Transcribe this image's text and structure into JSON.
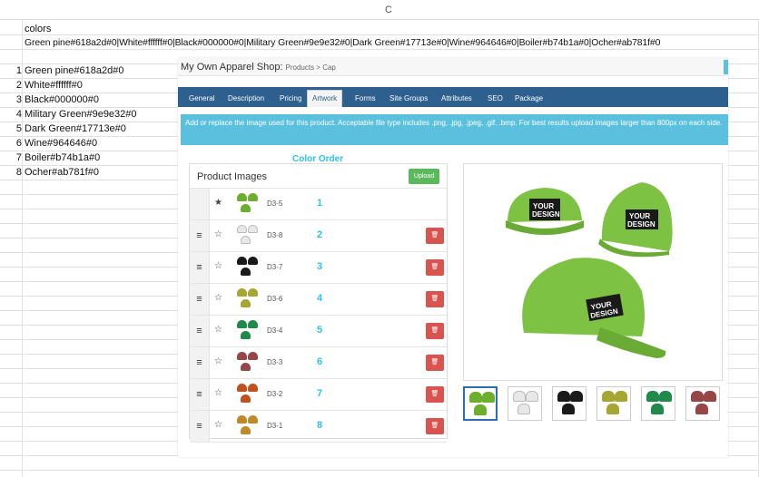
{
  "sheet": {
    "column_letter": "C",
    "header_cell": "colors",
    "colors_string": "Green pine#618a2d#0|White#ffffff#0|Black#000000#0|Military Green#9e9e32#0|Dark Green#17713e#0|Wine#964646#0|Boiler#b74b1a#0|Ocher#ab781f#0",
    "rows": [
      {
        "num": "1",
        "value": "Green pine#618a2d#0"
      },
      {
        "num": "2",
        "value": "White#ffffff#0"
      },
      {
        "num": "3",
        "value": "Black#000000#0"
      },
      {
        "num": "4",
        "value": "Military Green#9e9e32#0"
      },
      {
        "num": "5",
        "value": "Dark Green#17713e#0"
      },
      {
        "num": "6",
        "value": "Wine#964646#0"
      },
      {
        "num": "7",
        "value": "Boiler#b74b1a#0"
      },
      {
        "num": "8",
        "value": "Ocher#ab781f#0"
      }
    ]
  },
  "app": {
    "title": "My Own Apparel Shop:",
    "breadcrumb": "Products > Cap",
    "tabs": [
      "General",
      "Description",
      "Pricing",
      "Artwork",
      "Forms",
      "Site Groups",
      "Attributes",
      "SEO",
      "Package"
    ],
    "active_tab": "Artwork",
    "info_text": "Add or replace the image used for this product. Acceptable file type includes .png, .jpg, .jpeg, .gif, .bmp. For best results upload images larger than 800px on each side.",
    "panel_title": "Product Images",
    "upload_label": "Upload",
    "annotation": "Color Order",
    "images": [
      {
        "code": "D3-5",
        "order": "1",
        "primary": true,
        "color": "#6cae2e"
      },
      {
        "code": "D3-8",
        "order": "2",
        "primary": false,
        "color": "#e8e8e8"
      },
      {
        "code": "D3-7",
        "order": "3",
        "primary": false,
        "color": "#1a1a1a"
      },
      {
        "code": "D3-6",
        "order": "4",
        "primary": false,
        "color": "#a6a632"
      },
      {
        "code": "D3-4",
        "order": "5",
        "primary": false,
        "color": "#1f8a4a"
      },
      {
        "code": "D3-3",
        "order": "6",
        "primary": false,
        "color": "#964646"
      },
      {
        "code": "D3-2",
        "order": "7",
        "primary": false,
        "color": "#c0521f"
      },
      {
        "code": "D3-1",
        "order": "8",
        "primary": false,
        "color": "#c08a2a"
      }
    ],
    "design_text_1": "YOUR",
    "design_text_2": "DESIGN",
    "preview_color": "#7dc242",
    "swatch_colors": [
      "#6cae2e",
      "#e8e8e8",
      "#1a1a1a",
      "#a6a632",
      "#1f8a4a",
      "#964646"
    ]
  }
}
